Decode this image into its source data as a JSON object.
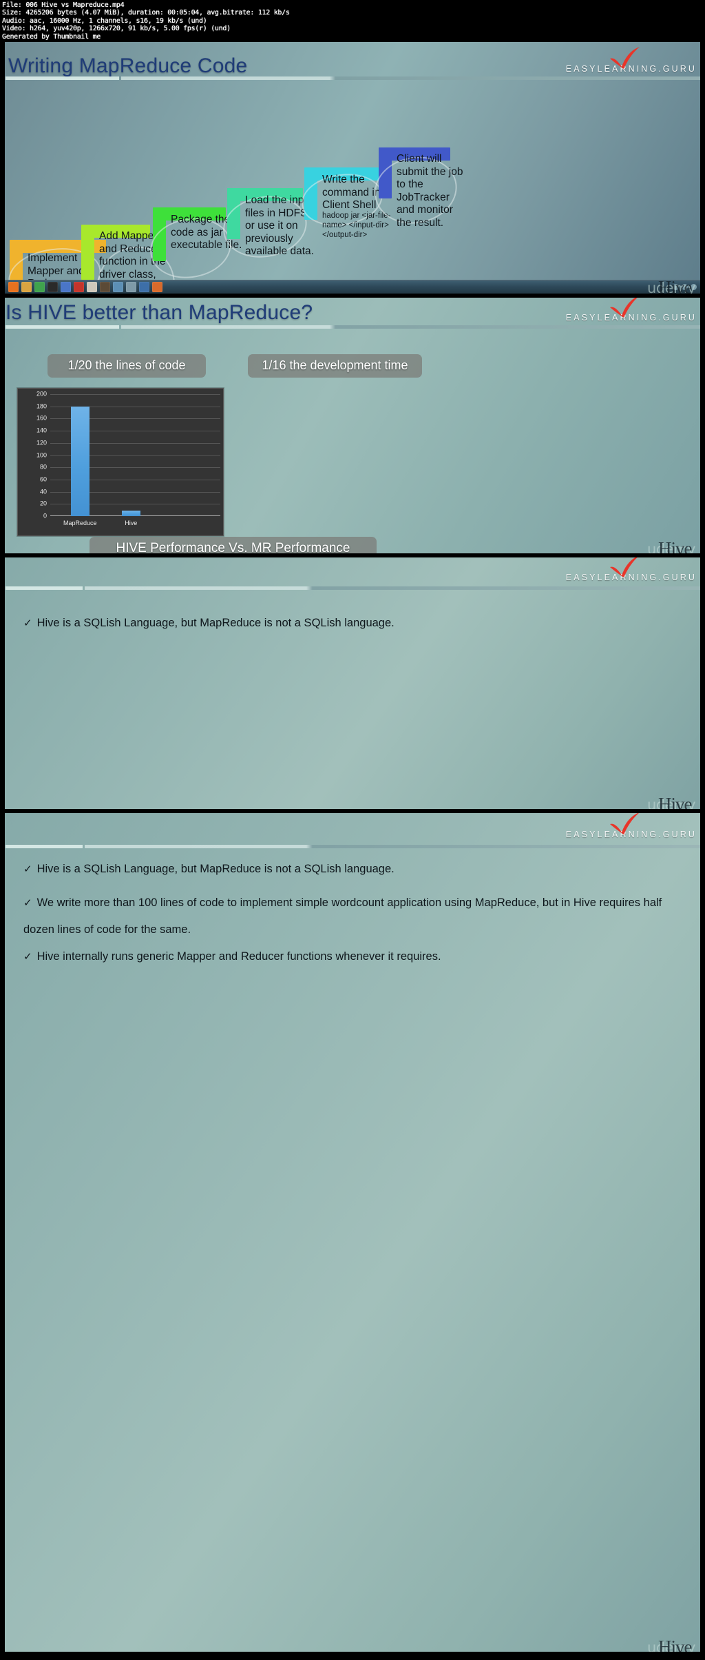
{
  "meta_header": {
    "lines": [
      "File: 006 Hive vs Mapreduce.mp4",
      "Size: 4265206 bytes (4.07 MiB), duration: 00:05:04, avg.bitrate: 112 kb/s",
      "Audio: aac, 16000 Hz, 1 channels, s16, 19 kb/s (und)",
      "Video: h264, yuv420p, 1266x720, 91 kb/s, 5.00 fps(r) (und)",
      "Generated by Thumbnail me"
    ]
  },
  "brand": {
    "logo_text": "EASYLEARNING.GURU",
    "check_icon": "red-check-icon",
    "accent_red": "#e8352a",
    "title_color": "#1f3c78"
  },
  "watermark": {
    "udemy": "udemy",
    "hive": "Hive",
    "dots": "□□.□□.□□"
  },
  "slides": [
    {
      "id": "slide-writing-mapreduce-code",
      "title": "Writing MapReduce Code",
      "steps": [
        {
          "text": "Implement Mapper and Reducer Function.",
          "sub": "",
          "color": "#f0b32d",
          "arrow_color": "#f5d033"
        },
        {
          "text": "Add Mapper and Reducer function in the driver class, from where the program invokes.",
          "sub": "",
          "color": "#a8e82c",
          "arrow_color": "#b8ef3a"
        },
        {
          "text": "Package the code as jar executable file.",
          "sub": "",
          "color": "#3ee03a",
          "arrow_color": "#3ad93a"
        },
        {
          "text": "Load the input files in HDFS or use it on previously available data.",
          "sub": "",
          "color": "#3fd9a0",
          "arrow_color": "#3fd2a8"
        },
        {
          "text": "Write the command in Client Shell",
          "sub": "hadoop jar <jar-file-name> </input-dir> </output-dir>",
          "color": "#38d2e0",
          "arrow_color": "#36b8de"
        },
        {
          "text": "Client will submit the job to the JobTracker and monitor the result.",
          "sub": "",
          "color": "#4159c9",
          "arrow_color": "#4159c9"
        }
      ],
      "taskbar": {
        "icons": [
          "firefox-icon",
          "folder-icon",
          "chrome-icon",
          "terminal-icon",
          "files-icon",
          "recorder-icon",
          "package-icon",
          "settings-icon",
          "gimp-icon",
          "window-icon",
          "app-icon",
          "media-icon"
        ],
        "tray": [
          "network-icon",
          "volume-icon",
          "clock-icon"
        ]
      }
    },
    {
      "id": "slide-is-hive-better",
      "title": "Is HIVE better than MapReduce?",
      "pill_left": "1/20  the lines of code",
      "pill_right": "1/16 the development time",
      "caption": "HIVE Performance Vs. MR Performance"
    },
    {
      "id": "slide-hive-sqlish-1",
      "title": "",
      "bullets": [
        "Hive is a SQLish Language, but MapReduce is not a SQLish language."
      ]
    },
    {
      "id": "slide-hive-sqlish-2",
      "title": "",
      "bullets": [
        "Hive is a SQLish Language, but MapReduce is not a SQLish language.",
        "We write more than 100 lines of code to implement simple wordcount application using MapReduce, but in Hive requires half dozen lines of code for the same.",
        "Hive internally runs generic Mapper and Reducer functions whenever it requires."
      ]
    }
  ],
  "chart_data": {
    "type": "bar",
    "title": "HIVE Performance Vs. MR Performance",
    "categories": [
      "MapReduce",
      "Hive"
    ],
    "values": [
      180,
      9
    ],
    "xlabel": "",
    "ylabel": "",
    "ylim": [
      0,
      200
    ],
    "yticks": [
      0,
      20,
      40,
      60,
      80,
      100,
      120,
      140,
      160,
      180,
      200
    ],
    "grid": true,
    "legend": "none",
    "bar_color": "#4f9fdd",
    "plot_background": "#343434"
  }
}
